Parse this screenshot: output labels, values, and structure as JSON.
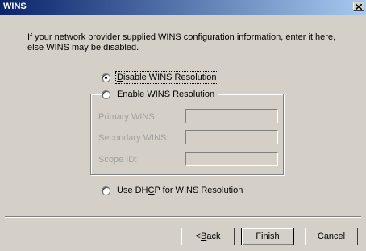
{
  "window": {
    "title": "WINS"
  },
  "intro_text": "If your network provider supplied WINS configuration information, enter it here, else WINS may be disabled.",
  "options": {
    "disable": {
      "pre": "",
      "accel": "D",
      "post": "isable WINS Resolution",
      "checked": true
    },
    "enable": {
      "pre": "Enable ",
      "accel": "W",
      "post": "INS Resolution",
      "checked": false
    },
    "dhcp": {
      "pre": "Use DH",
      "accel": "C",
      "post": "P for WINS Resolution",
      "checked": false
    }
  },
  "fields": {
    "primary_label": "Primary WINS:",
    "secondary_label": "Secondary WINS:",
    "scope_label": "Scope ID:"
  },
  "buttons": {
    "back": {
      "pre": "< ",
      "accel": "B",
      "post": "ack"
    },
    "finish": "Finish",
    "cancel": "Cancel"
  }
}
